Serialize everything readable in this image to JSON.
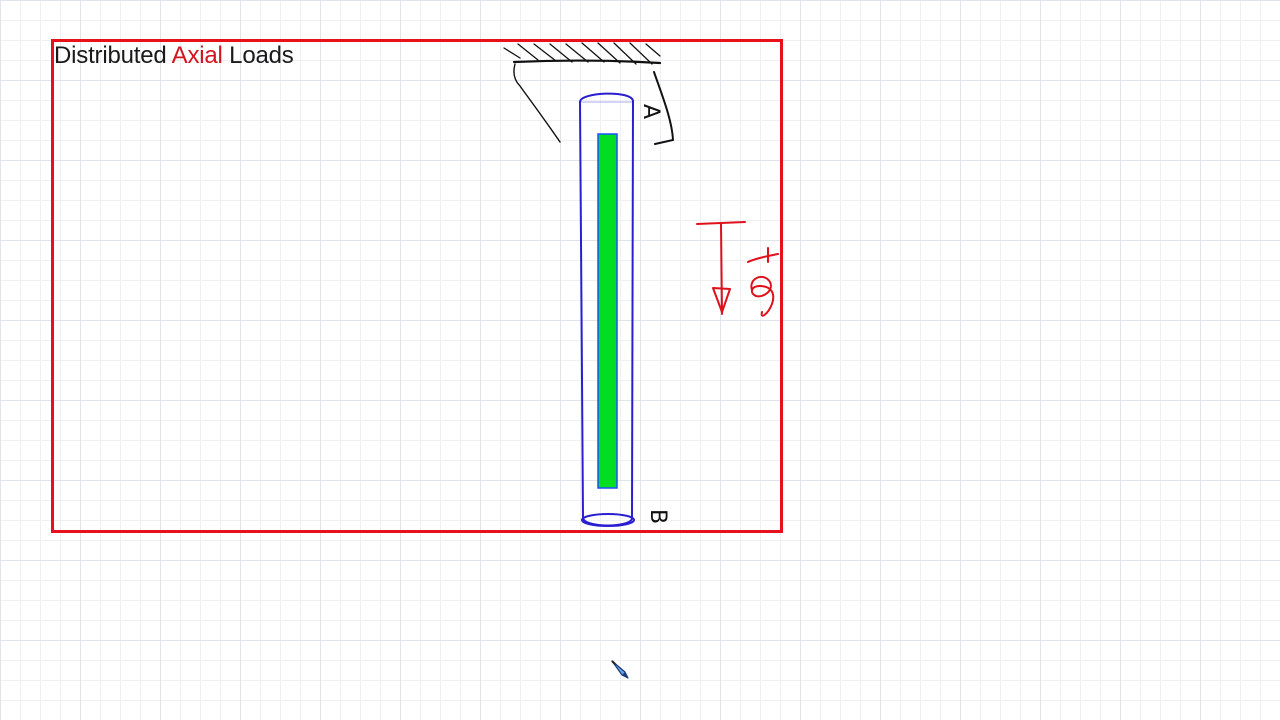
{
  "title": {
    "part1": "Distributed",
    "part2": "Axial",
    "part3": "Loads"
  },
  "colors": {
    "frame": "#e8101a",
    "title_highlight": "#d3141c",
    "rod_outline": "#2a1fd0",
    "rod_fill": "#00dd22",
    "rod_fill_border": "#1a50ff",
    "load_arrow": "#e0101a",
    "ink": "#111111"
  },
  "diagram": {
    "top_label": "A",
    "bottom_label": "B",
    "load_label": "q",
    "arrow_direction": "down",
    "support": "fixed wall at top"
  },
  "icons": {
    "cursor": "pen-cursor-icon"
  }
}
